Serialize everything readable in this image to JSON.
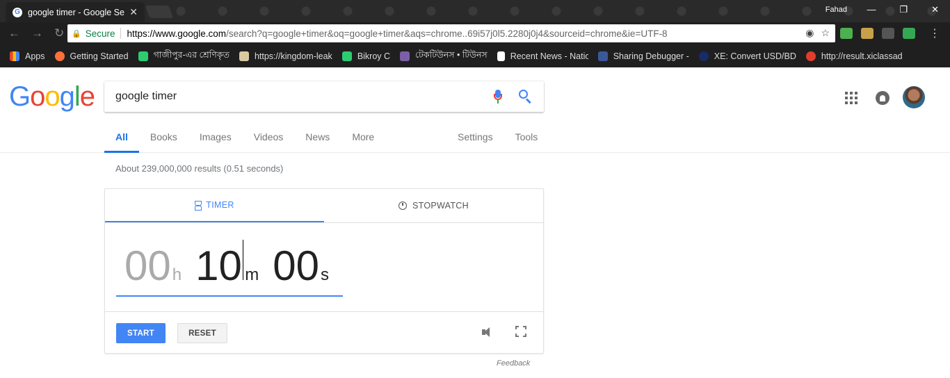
{
  "browser": {
    "tab_title": "google timer - Google Se",
    "user": "Fahad",
    "secure_label": "Secure",
    "url_host": "https://www.google.com",
    "url_path": "/search?q=google+timer&oq=google+timer&aqs=chrome..69i57j0l5.2280j0j4&sourceid=chrome&ie=UTF-8",
    "bookmarks": [
      {
        "label": "Apps",
        "color": "#e0e0e0"
      },
      {
        "label": "Getting Started",
        "color": "#ff7139"
      },
      {
        "label": "গাজীপুর-এর শ্রেণিকৃত",
        "color": "#2ecc71"
      },
      {
        "label": "https://kingdom-leak",
        "color": "#d9c9a3"
      },
      {
        "label": "Bikroy C",
        "color": "#2ecc71"
      },
      {
        "label": "টেকটিউনস • টিউনস",
        "color": "#7b5ea7"
      },
      {
        "label": "Recent News - Natio",
        "color": "#ffffff"
      },
      {
        "label": "Sharing Debugger -",
        "color": "#3b5998"
      },
      {
        "label": "XE: Convert USD/BD",
        "color": "#1a2b6b"
      },
      {
        "label": "http://result.xiclassad",
        "color": "#e03e2d"
      }
    ],
    "badge_count": "1"
  },
  "search": {
    "query": "google timer",
    "logo": "Google"
  },
  "nav_tabs": {
    "left": [
      "All",
      "Books",
      "Images",
      "Videos",
      "News",
      "More"
    ],
    "right": [
      "Settings",
      "Tools"
    ]
  },
  "results": {
    "count_text": "About 239,000,000 results (0.51 seconds)"
  },
  "timer_widget": {
    "tab_timer": "TIMER",
    "tab_stopwatch": "STOPWATCH",
    "hours": "00",
    "hours_unit": "h",
    "minutes": "10",
    "minutes_unit": "m",
    "seconds": "00",
    "seconds_unit": "s",
    "start_label": "START",
    "reset_label": "RESET",
    "feedback_label": "Feedback"
  },
  "colors": {
    "accent": "#4285f4",
    "secure": "#0b8043"
  }
}
